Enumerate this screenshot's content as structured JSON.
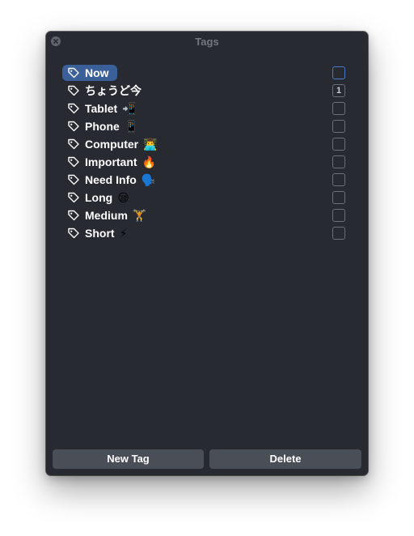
{
  "window": {
    "title": "Tags"
  },
  "tags": [
    {
      "name": "Now",
      "emoji": "",
      "selected": true,
      "count": ""
    },
    {
      "name": "ちょうど今",
      "emoji": "",
      "selected": false,
      "count": "1"
    },
    {
      "name": "Tablet",
      "emoji": "📲",
      "selected": false,
      "count": ""
    },
    {
      "name": "Phone",
      "emoji": "📱",
      "selected": false,
      "count": ""
    },
    {
      "name": "Computer",
      "emoji": "👨‍💻",
      "selected": false,
      "count": ""
    },
    {
      "name": "Important",
      "emoji": "🔥",
      "selected": false,
      "count": ""
    },
    {
      "name": "Need Info",
      "emoji": "🗣️",
      "selected": false,
      "count": ""
    },
    {
      "name": "Long",
      "emoji": "😪",
      "selected": false,
      "count": ""
    },
    {
      "name": "Medium",
      "emoji": "🏋️",
      "selected": false,
      "count": ""
    },
    {
      "name": "Short",
      "emoji": "⚡",
      "selected": false,
      "count": ""
    }
  ],
  "buttons": {
    "new_tag": "New Tag",
    "delete": "Delete"
  },
  "colors": {
    "window_bg": "#272a31",
    "selection": "#3b5f98",
    "button_bg": "#4a4e57",
    "title_text": "#73777f"
  }
}
